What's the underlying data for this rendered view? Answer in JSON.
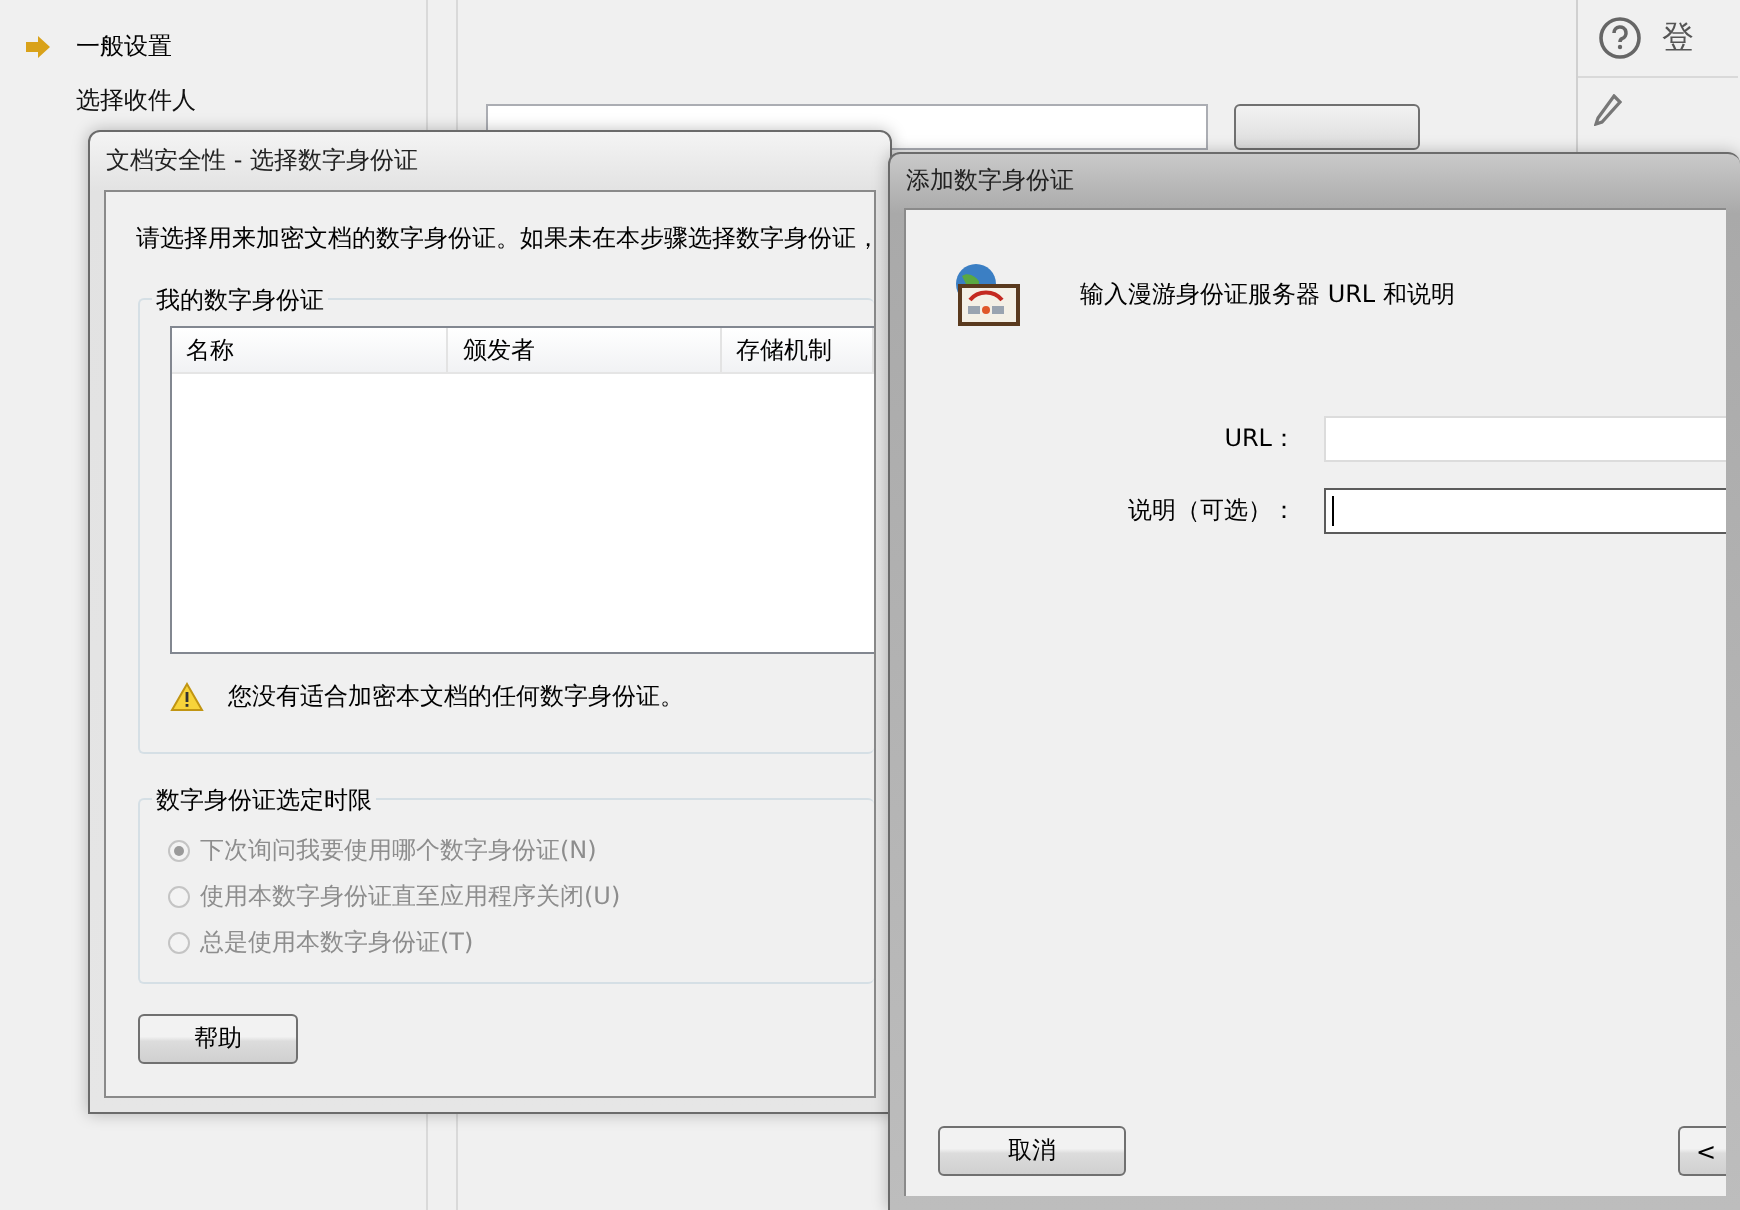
{
  "sidebar": {
    "items": [
      {
        "label": "一般设置",
        "selected": true
      },
      {
        "label": "选择收件人",
        "selected": false
      }
    ]
  },
  "right_panel": {
    "label": "登"
  },
  "dialog_select": {
    "title": "文档安全性 - 选择数字身份证",
    "intro": "请选择用来加密文档的数字身份证。如果未在本步骤选择数字身份证，",
    "certs": {
      "title": "我的数字身份证",
      "columns": [
        "名称",
        "颁发者",
        "存储机制"
      ],
      "warning": "您没有适合加密本文档的任何数字身份证。"
    },
    "timing": {
      "title": "数字身份证选定时限",
      "options": [
        {
          "label": "下次询问我要使用哪个数字身份证(N)",
          "selected": true,
          "disabled": true
        },
        {
          "label": "使用本数字身份证直至应用程序关闭(U)",
          "selected": false,
          "disabled": true
        },
        {
          "label": "总是使用本数字身份证(T)",
          "selected": false,
          "disabled": true
        }
      ]
    },
    "buttons": [
      "帮助"
    ]
  },
  "dialog_add": {
    "title": "添加数字身份证",
    "heading": "输入漫游身份证服务器 URL 和说明",
    "fields": [
      {
        "label": "URL：",
        "focused": false
      },
      {
        "label": "说明（可选）：",
        "focused": true
      }
    ],
    "buttons": [
      "取消",
      "<"
    ]
  }
}
